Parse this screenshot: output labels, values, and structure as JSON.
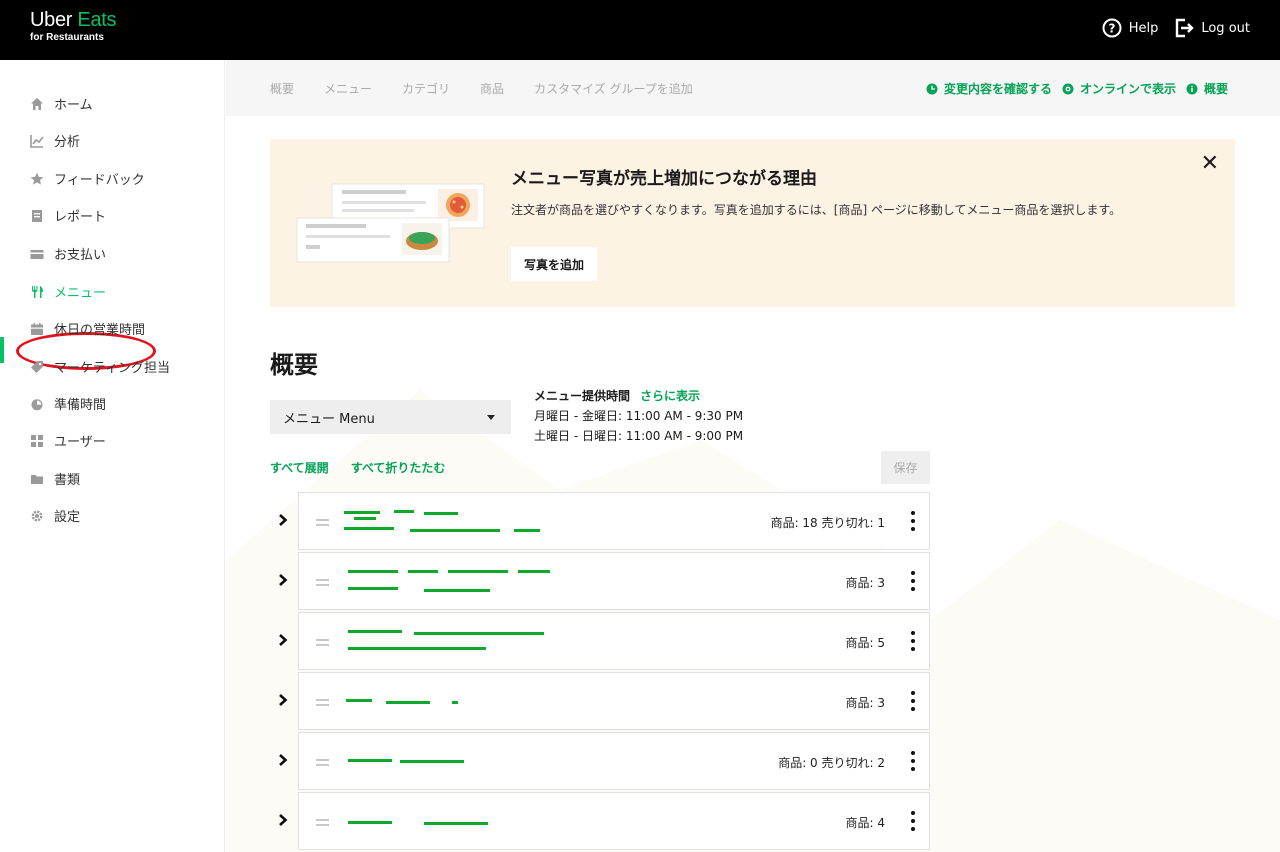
{
  "brand": {
    "line1_a": "Uber ",
    "line1_b": "Eats",
    "line2": "for Restaurants"
  },
  "topnav": {
    "help": "Help",
    "logout": "Log out"
  },
  "sidebar": {
    "items": [
      {
        "label": "ホーム",
        "icon": "home-icon"
      },
      {
        "label": "分析",
        "icon": "chart-icon"
      },
      {
        "label": "フィードバック",
        "icon": "star-icon"
      },
      {
        "label": "レポート",
        "icon": "document-icon"
      },
      {
        "label": "お支払い",
        "icon": "card-icon"
      },
      {
        "label": "メニュー",
        "icon": "fork-knife-icon",
        "active": true
      },
      {
        "label": "休日の営業時間",
        "icon": "calendar-icon"
      },
      {
        "label": "マーケティング担当",
        "icon": "tag-icon"
      },
      {
        "label": "準備時間",
        "icon": "timer-icon"
      },
      {
        "label": "ユーザー",
        "icon": "users-icon"
      },
      {
        "label": "書類",
        "icon": "folder-icon"
      },
      {
        "label": "設定",
        "icon": "gear-icon"
      }
    ]
  },
  "subnav": {
    "tabs": [
      "概要",
      "メニュー",
      "カテゴリ",
      "商品",
      "カスタマイズ グループを追加"
    ],
    "links": [
      "変更内容を確認する",
      "オンラインで表示",
      "概要"
    ]
  },
  "banner": {
    "title": "メニュー写真が売上増加につながる理由",
    "desc": "注文者が商品を選びやすくなります。写真を追加するには、[商品] ページに移動してメニュー商品を選択します。",
    "button": "写真を追加",
    "close": "✕"
  },
  "main": {
    "heading": "概要",
    "menu_select": "メニュー Menu",
    "hours_title": "メニュー提供時間",
    "hours_more": "さらに表示",
    "hours": [
      "月曜日 - 金曜日: 11:00 AM - 9:30 PM",
      "土曜日 - 日曜日: 11:00 AM - 9:00 PM"
    ],
    "expand_all": "すべて展開",
    "collapse_all": "すべて折りたたむ",
    "save": "保存"
  },
  "categories": [
    {
      "count": "商品: 18  売り切れ: 1"
    },
    {
      "count": "商品: 3"
    },
    {
      "count": "商品: 5"
    },
    {
      "count": "商品: 3"
    },
    {
      "count": "商品: 0  売り切れ: 2"
    },
    {
      "count": "商品: 4"
    }
  ],
  "colors": {
    "accent": "#06c167",
    "annotation": "#e0141e",
    "banner_bg": "#fdf3e5"
  }
}
